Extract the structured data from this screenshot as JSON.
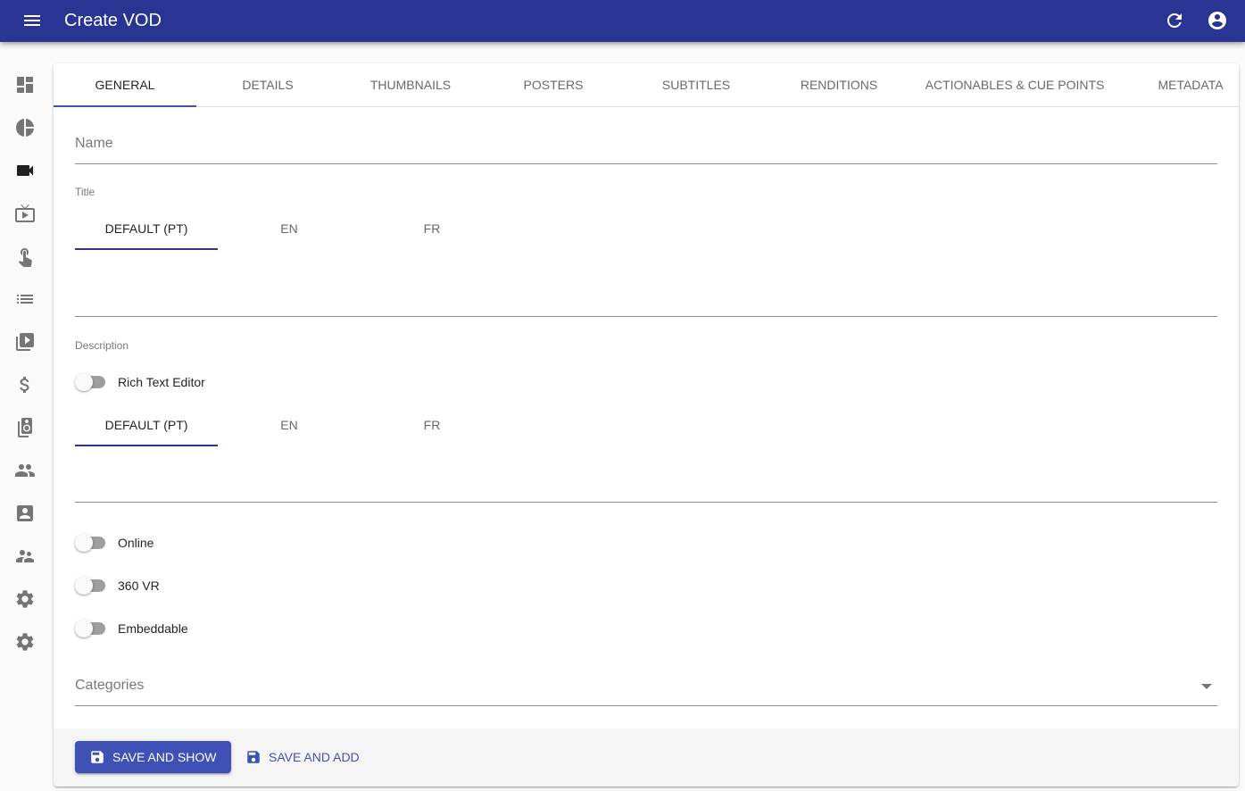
{
  "appbar": {
    "title": "Create VOD",
    "menu_icon": "menu-icon",
    "actions": [
      {
        "name": "refresh",
        "icon": "refresh-icon"
      },
      {
        "name": "account",
        "icon": "account-circle-icon"
      }
    ]
  },
  "sidebar": {
    "items": [
      {
        "icon": "dashboard-icon",
        "active": false
      },
      {
        "icon": "pie-chart-icon",
        "active": false
      },
      {
        "icon": "videocam-icon",
        "active": true
      },
      {
        "icon": "live-tv-icon",
        "active": false
      },
      {
        "icon": "touch-app-icon",
        "active": false
      },
      {
        "icon": "list-icon",
        "active": false
      },
      {
        "icon": "video-library-icon",
        "active": false
      },
      {
        "icon": "dollar-icon",
        "active": false
      },
      {
        "icon": "speaker-group-icon",
        "active": false
      },
      {
        "icon": "people-icon",
        "active": false
      },
      {
        "icon": "account-box-icon",
        "active": false
      },
      {
        "icon": "supervisor-account-icon",
        "active": false
      },
      {
        "icon": "settings-icon",
        "active": false
      },
      {
        "icon": "settings-icon",
        "active": false
      }
    ]
  },
  "tabs": [
    {
      "label": "GENERAL",
      "active": true
    },
    {
      "label": "DETAILS",
      "active": false
    },
    {
      "label": "THUMBNAILS",
      "active": false
    },
    {
      "label": "POSTERS",
      "active": false
    },
    {
      "label": "SUBTITLES",
      "active": false
    },
    {
      "label": "RENDITIONS",
      "active": false
    },
    {
      "label": "ACTIONABLES & CUE POINTS",
      "active": false
    },
    {
      "label": "METADATA",
      "active": false
    }
  ],
  "form": {
    "name": {
      "placeholder": "Name",
      "value": ""
    },
    "title": {
      "label": "Title",
      "languages": [
        {
          "label": "DEFAULT (PT)",
          "active": true
        },
        {
          "label": "EN",
          "active": false
        },
        {
          "label": "FR",
          "active": false
        }
      ],
      "value": ""
    },
    "description": {
      "label": "Description",
      "rich_text_toggle": {
        "label": "Rich Text Editor",
        "checked": false
      },
      "languages": [
        {
          "label": "DEFAULT (PT)",
          "active": true
        },
        {
          "label": "EN",
          "active": false
        },
        {
          "label": "FR",
          "active": false
        }
      ],
      "value": ""
    },
    "toggles": [
      {
        "label": "Online",
        "checked": false
      },
      {
        "label": "360 VR",
        "checked": false
      },
      {
        "label": "Embeddable",
        "checked": false
      }
    ],
    "categories": {
      "placeholder": "Categories",
      "value": ""
    }
  },
  "toolbar": {
    "save_and_show": "SAVE AND SHOW",
    "save_and_add": "SAVE AND ADD",
    "save_icon": "save-icon"
  },
  "colors": {
    "appbar": "#283593",
    "primary": "#3f51b5",
    "background": "#fafafa"
  }
}
